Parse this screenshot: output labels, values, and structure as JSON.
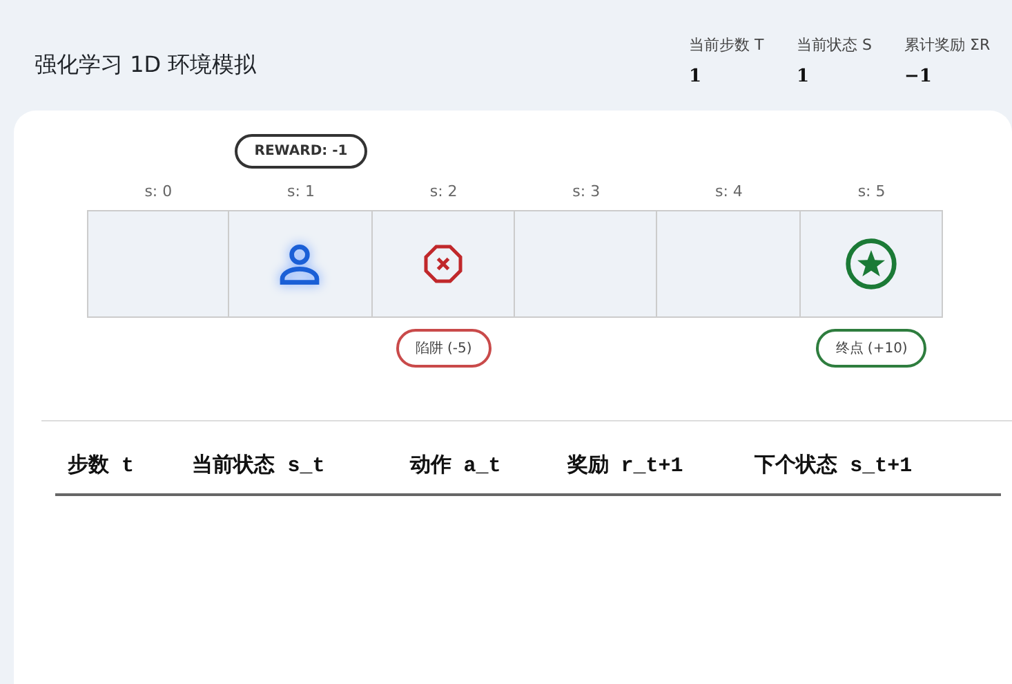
{
  "title": "强化学习 1D 环境模拟",
  "stats": [
    {
      "label": "当前步数 T",
      "value": "1"
    },
    {
      "label": "当前状态 S",
      "value": "1"
    },
    {
      "label": "累计奖励 ΣR",
      "value": "−1"
    }
  ],
  "reward_bubble": "REWARD: -1",
  "cells": [
    {
      "label": "s: 0",
      "kind": "empty",
      "selected": false
    },
    {
      "label": "s: 1",
      "kind": "empty",
      "selected": true
    },
    {
      "label": "s: 2",
      "kind": "trap",
      "selected": false,
      "tag": "陷阱 (-5)"
    },
    {
      "label": "s: 3",
      "kind": "empty",
      "selected": false
    },
    {
      "label": "s: 4",
      "kind": "empty",
      "selected": false
    },
    {
      "label": "s: 5",
      "kind": "goal",
      "selected": false,
      "tag": "终点 (+10)"
    }
  ],
  "table": {
    "columns": [
      "步数 t",
      "当前状态 s_t",
      "动作 a_t",
      "奖励 r_t+1",
      "下个状态 s_t+1"
    ]
  }
}
